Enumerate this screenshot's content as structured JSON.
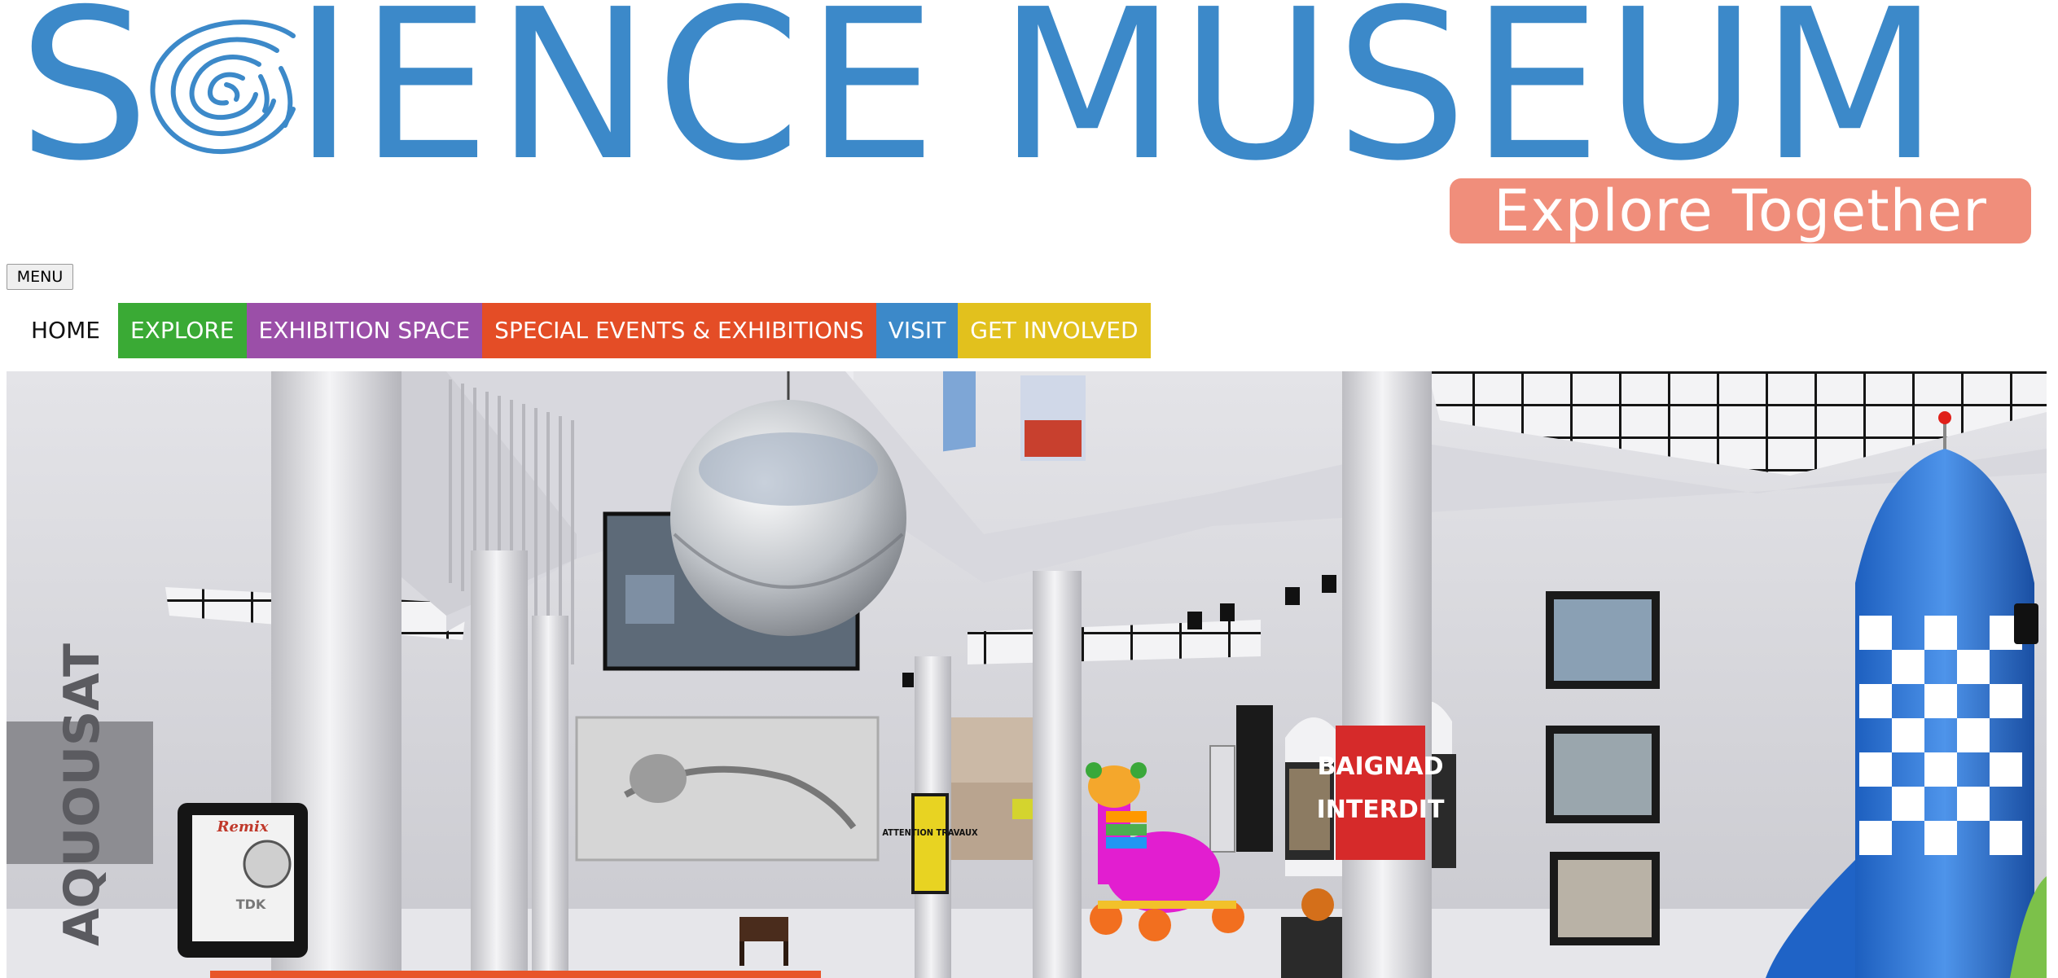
{
  "header": {
    "logo_text_parts": [
      "S",
      "IENCE",
      "MUSEUM"
    ],
    "logo_alt": "SCIENCE MUSEUM",
    "tagline": "Explore Together",
    "brand_color": "#3c89c9",
    "tagline_bg": "#f08e7b"
  },
  "menu_button": {
    "label": "MENU"
  },
  "nav": {
    "items": [
      {
        "label": "HOME",
        "color": "#ffffff"
      },
      {
        "label": "EXPLORE",
        "color": "#3aaa35"
      },
      {
        "label": "EXHIBITION SPACE",
        "color": "#9b4fa8"
      },
      {
        "label": "SPECIAL EVENTS & EXHIBITIONS",
        "color": "#e44d26"
      },
      {
        "label": "VISIT",
        "color": "#3c89c9"
      },
      {
        "label": "GET INVOLVED",
        "color": "#e2c11d"
      }
    ]
  },
  "hero": {
    "signs": {
      "left_wall": "AQUOUSAT",
      "pillar_sign": "ATTENTION TRAVAUX",
      "red_banner_line1": "BAIGNAD",
      "red_banner_line2": "INTERDIT",
      "cassette_brand": "Remix",
      "cassette_maker": "TDK"
    }
  }
}
